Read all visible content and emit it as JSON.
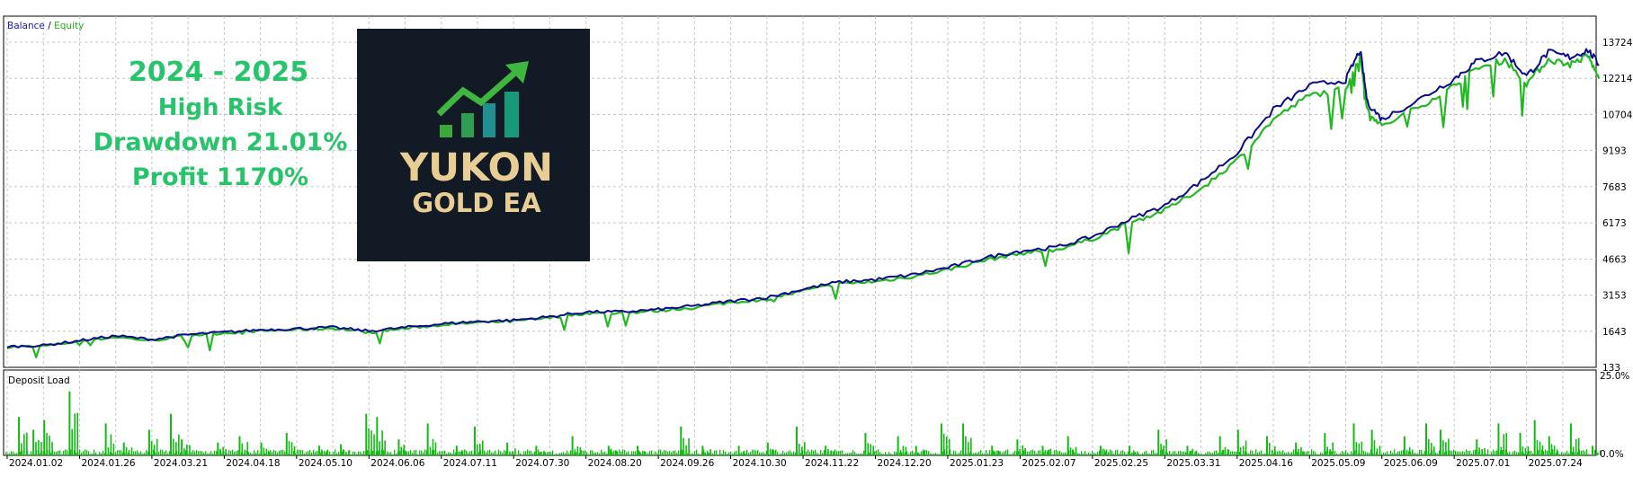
{
  "legend": {
    "balance": "Balance",
    "separator": " / ",
    "equity": "Equity"
  },
  "promo": {
    "lines": [
      "2024 - 2025",
      "High Risk",
      "Drawdown 21.01%",
      "Profit 1170%"
    ]
  },
  "logo": {
    "line1": "YUKON",
    "line2": "GOLD EA",
    "icon": "rising-bar-chart-arrow-icon"
  },
  "colors": {
    "balance": "#0a0a8c",
    "equity": "#22b822",
    "deposit_load": "#11bb11",
    "promo_text": "#27c46b",
    "logo_bg": "#121a26",
    "logo_text": "#e8cd94",
    "grid": "#c4c4c4"
  },
  "chart_data": [
    {
      "type": "line",
      "title": "",
      "legend": [
        "Balance",
        "Equity"
      ],
      "y_ticks": [
        "13724",
        "12214",
        "10704",
        "9193",
        "7683",
        "6173",
        "4663",
        "3153",
        "1643",
        "133"
      ],
      "ylim": [
        133,
        14480
      ],
      "grid": true,
      "x": [
        "2024.01.02",
        "2024.01.26",
        "2024.03.21",
        "2024.04.18",
        "2024.05.10",
        "2024.06.06",
        "2024.07.11",
        "2024.07.30",
        "2024.08.20",
        "2024.09.26",
        "2024.10.30",
        "2024.11.22",
        "2024.12.20",
        "2025.01.23",
        "2025.02.07",
        "2025.02.25",
        "2025.03.31",
        "2025.04.16",
        "2025.05.09",
        "2025.06.09",
        "2025.07.01",
        "2025.07.24"
      ],
      "series": [
        {
          "name": "Balance",
          "values": [
            [
              0,
              1000
            ],
            [
              0.5,
              1050
            ],
            [
              1,
              1250
            ],
            [
              1.5,
              1450
            ],
            [
              2,
              1300
            ],
            [
              2.5,
              1500
            ],
            [
              3,
              1600
            ],
            [
              3.5,
              1700
            ],
            [
              4,
              1750
            ],
            [
              4.5,
              1800
            ],
            [
              5,
              1650
            ],
            [
              5.5,
              1800
            ],
            [
              6,
              1950
            ],
            [
              6.5,
              2050
            ],
            [
              7,
              2100
            ],
            [
              7.5,
              2250
            ],
            [
              8,
              2450
            ],
            [
              8.5,
              2450
            ],
            [
              9,
              2550
            ],
            [
              9.5,
              2700
            ],
            [
              10,
              2900
            ],
            [
              10.5,
              3050
            ],
            [
              11,
              3400
            ],
            [
              11.5,
              3700
            ],
            [
              12,
              3800
            ],
            [
              12.5,
              4000
            ],
            [
              13,
              4300
            ],
            [
              13.5,
              4700
            ],
            [
              14,
              5000
            ],
            [
              14.5,
              5150
            ],
            [
              15,
              5600
            ],
            [
              15.5,
              6300
            ],
            [
              16,
              6900
            ],
            [
              16.5,
              7900
            ],
            [
              17,
              9100
            ],
            [
              17.5,
              10900
            ],
            [
              18,
              11900
            ],
            [
              18.5,
              12150
            ],
            [
              18.7,
              13400
            ],
            [
              18.8,
              11200
            ],
            [
              19,
              10500
            ],
            [
              19.5,
              11300
            ],
            [
              20,
              12200
            ],
            [
              20.3,
              12900
            ],
            [
              20.7,
              13300
            ],
            [
              21,
              12300
            ],
            [
              21.3,
              13300
            ],
            [
              21.6,
              13100
            ],
            [
              21.85,
              13400
            ],
            [
              22,
              12800
            ]
          ]
        },
        {
          "name": "Equity",
          "values": [
            [
              0,
              980
            ],
            [
              0.5,
              1020
            ],
            [
              1,
              1220
            ],
            [
              1.5,
              1400
            ],
            [
              2,
              1250
            ],
            [
              2.5,
              1470
            ],
            [
              3,
              1570
            ],
            [
              3.5,
              1660
            ],
            [
              4,
              1710
            ],
            [
              4.5,
              1770
            ],
            [
              5,
              1600
            ],
            [
              5.5,
              1760
            ],
            [
              6,
              1910
            ],
            [
              6.5,
              2000
            ],
            [
              7,
              2060
            ],
            [
              7.5,
              2200
            ],
            [
              8,
              2400
            ],
            [
              8.5,
              2400
            ],
            [
              9,
              2500
            ],
            [
              9.5,
              2640
            ],
            [
              10,
              2850
            ],
            [
              10.5,
              2980
            ],
            [
              11,
              3330
            ],
            [
              11.5,
              3620
            ],
            [
              12,
              3720
            ],
            [
              12.5,
              3920
            ],
            [
              13,
              4220
            ],
            [
              13.5,
              4600
            ],
            [
              14,
              4900
            ],
            [
              14.5,
              5050
            ],
            [
              15,
              5500
            ],
            [
              15.5,
              6150
            ],
            [
              16,
              6700
            ],
            [
              16.5,
              7600
            ],
            [
              17,
              8800
            ],
            [
              17.5,
              10500
            ],
            [
              18,
              11500
            ],
            [
              18.5,
              11800
            ],
            [
              18.7,
              13200
            ],
            [
              18.8,
              10900
            ],
            [
              19,
              10200
            ],
            [
              19.5,
              11000
            ],
            [
              20,
              11900
            ],
            [
              20.3,
              12600
            ],
            [
              20.7,
              13000
            ],
            [
              21,
              12000
            ],
            [
              21.3,
              13000
            ],
            [
              21.6,
              12800
            ],
            [
              21.85,
              13150
            ],
            [
              22,
              12200
            ]
          ]
        }
      ]
    },
    {
      "type": "bar",
      "title": "Deposit Load",
      "y_ticks": [
        "25.0%",
        "0.0%"
      ],
      "ylim": [
        0,
        25
      ],
      "grid": true,
      "categories": [
        "2024.01.02",
        "2024.01.26",
        "2024.03.21",
        "2024.04.18",
        "2024.05.10",
        "2024.06.06",
        "2024.07.11",
        "2024.07.30",
        "2024.08.20",
        "2024.09.26",
        "2024.10.30",
        "2024.11.22",
        "2024.12.20",
        "2025.01.23",
        "2025.02.07",
        "2025.02.25",
        "2025.03.31",
        "2025.04.16",
        "2025.05.09",
        "2025.06.09",
        "2025.07.01",
        "2025.07.24"
      ],
      "spikes": [
        [
          0.15,
          12
        ],
        [
          0.35,
          8
        ],
        [
          0.5,
          11
        ],
        [
          0.85,
          20
        ],
        [
          1.35,
          10
        ],
        [
          1.6,
          4
        ],
        [
          1.95,
          8
        ],
        [
          2.25,
          13
        ],
        [
          2.4,
          5
        ],
        [
          2.9,
          4
        ],
        [
          3.2,
          6
        ],
        [
          3.5,
          4
        ],
        [
          3.85,
          7
        ],
        [
          4.3,
          3
        ],
        [
          4.6,
          3.5
        ],
        [
          4.95,
          13
        ],
        [
          5.1,
          12
        ],
        [
          5.4,
          5
        ],
        [
          5.8,
          10
        ],
        [
          6.2,
          3
        ],
        [
          6.45,
          9
        ],
        [
          6.9,
          4
        ],
        [
          7.3,
          3
        ],
        [
          7.8,
          6
        ],
        [
          8.3,
          3
        ],
        [
          8.7,
          3
        ],
        [
          9.3,
          9
        ],
        [
          9.6,
          3
        ],
        [
          10.1,
          3
        ],
        [
          10.5,
          4
        ],
        [
          10.9,
          9
        ],
        [
          11.3,
          3
        ],
        [
          11.85,
          7
        ],
        [
          12.3,
          6
        ],
        [
          12.55,
          3
        ],
        [
          12.9,
          10
        ],
        [
          13.2,
          10
        ],
        [
          13.6,
          3
        ],
        [
          13.95,
          5
        ],
        [
          14.3,
          3
        ],
        [
          14.65,
          6
        ],
        [
          15.1,
          3
        ],
        [
          15.5,
          3
        ],
        [
          15.9,
          8
        ],
        [
          16.3,
          3
        ],
        [
          16.75,
          6
        ],
        [
          17.0,
          8
        ],
        [
          17.4,
          6
        ],
        [
          17.8,
          4
        ],
        [
          18.2,
          7
        ],
        [
          18.6,
          10
        ],
        [
          18.85,
          8
        ],
        [
          19.3,
          6
        ],
        [
          19.6,
          10
        ],
        [
          19.8,
          8
        ],
        [
          20.3,
          5
        ],
        [
          20.6,
          10
        ],
        [
          20.9,
          7
        ],
        [
          21.1,
          11
        ],
        [
          21.3,
          6
        ],
        [
          21.6,
          10
        ],
        [
          21.9,
          3
        ]
      ]
    }
  ]
}
